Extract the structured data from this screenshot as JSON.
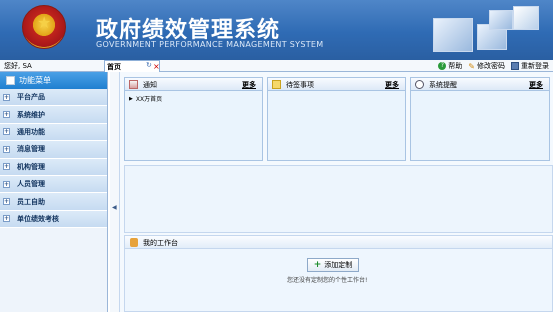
{
  "header": {
    "title": "政府绩效管理系统",
    "subtitle": "GOVERNMENT PERFORMANCE MANAGEMENT SYSTEM"
  },
  "status": {
    "greeting": "您好, SA"
  },
  "tabs": [
    {
      "label": "首页"
    }
  ],
  "toplinks": {
    "help": "帮助",
    "change_password": "修改密码",
    "relogin": "重新登录"
  },
  "sidebar": {
    "title": "功能菜单",
    "items": [
      {
        "label": "平台产品"
      },
      {
        "label": "系统维护"
      },
      {
        "label": "通用功能"
      },
      {
        "label": "消息管理"
      },
      {
        "label": "机构管理"
      },
      {
        "label": "人员管理"
      },
      {
        "label": "员工自助"
      },
      {
        "label": "单位绩效考核"
      }
    ]
  },
  "panels": {
    "notice": {
      "title": "通知",
      "more": "更多",
      "items": [
        "XX万首页"
      ]
    },
    "todo": {
      "title": "待签事项",
      "more": "更多"
    },
    "reminder": {
      "title": "系统提醒",
      "more": "更多"
    }
  },
  "workspace": {
    "title": "我的工作台",
    "add_button": "添加定制",
    "empty_text": "您还没有定制您的个性工作台!"
  },
  "colors": {
    "header": "#2f6bb4",
    "sidebar_head": "#1f7fd0",
    "panel_bg": "#eaf4fd"
  }
}
